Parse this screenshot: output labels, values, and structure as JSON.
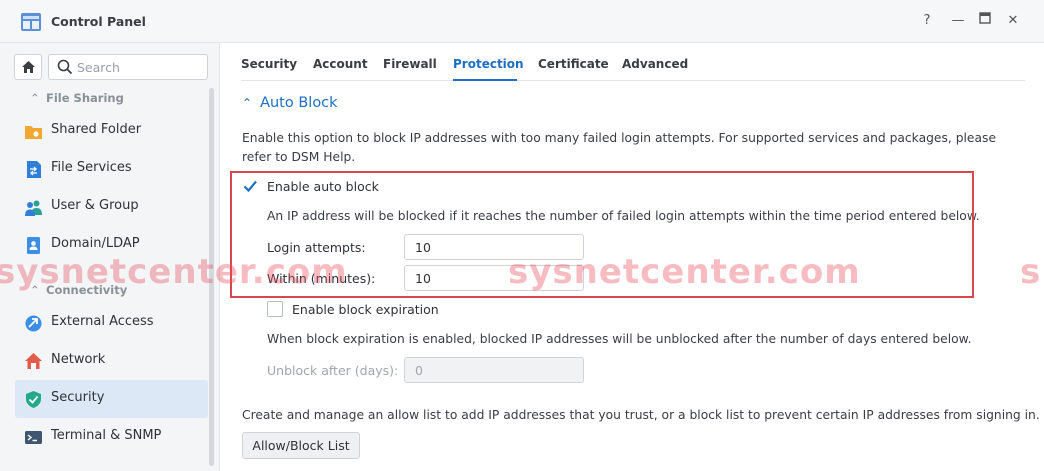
{
  "window": {
    "title": "Control Panel"
  },
  "window_controls": {
    "help": "?",
    "minimize": "—",
    "maximize": "□",
    "close": "✕"
  },
  "sidebar": {
    "search_placeholder": "Search",
    "sections": [
      {
        "label": "File Sharing"
      },
      {
        "label": "Connectivity"
      }
    ],
    "items": [
      {
        "label": "Shared Folder"
      },
      {
        "label": "File Services"
      },
      {
        "label": "User & Group"
      },
      {
        "label": "Domain/LDAP"
      },
      {
        "label": "External Access"
      },
      {
        "label": "Network"
      },
      {
        "label": "Security",
        "active": true
      },
      {
        "label": "Terminal & SNMP"
      }
    ]
  },
  "tabs": [
    {
      "label": "Security"
    },
    {
      "label": "Account"
    },
    {
      "label": "Firewall"
    },
    {
      "label": "Protection",
      "active": true
    },
    {
      "label": "Certificate"
    },
    {
      "label": "Advanced"
    }
  ],
  "auto_block": {
    "title": "Auto Block",
    "description": "Enable this option to block IP addresses with too many failed login attempts. For supported services and packages, please refer to DSM Help.",
    "enable_label": "Enable auto block",
    "enable_checked": true,
    "hint": "An IP address will be blocked if it reaches the number of failed login attempts within the time period entered below.",
    "login_attempts_label": "Login attempts:",
    "login_attempts_value": "10",
    "within_label": "Within (minutes):",
    "within_value": "10",
    "expiration_label": "Enable block expiration",
    "expiration_checked": false,
    "expiration_hint": "When block expiration is enabled, blocked IP addresses will be unblocked after the number of days entered below.",
    "unblock_label": "Unblock after (days):",
    "unblock_value": "0",
    "allow_list_text": "Create and manage an allow list to add IP addresses that you trust, or a block list to prevent certain IP addresses from signing in.",
    "allow_block_button": "Allow/Block List"
  },
  "watermark": {
    "text": "sysnetcenter.com",
    "partial": "s"
  },
  "colors": {
    "accent": "#1d6fc2",
    "highlight_border": "#d9474c",
    "active_nav_bg": "#dce8f5"
  }
}
